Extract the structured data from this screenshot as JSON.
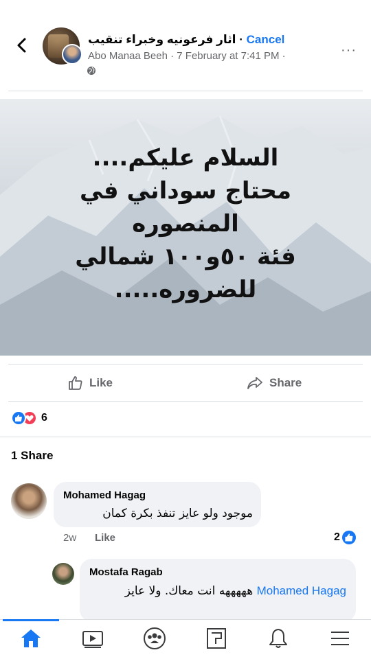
{
  "header": {
    "group_name": "اثار فرعونيه وخبراء تنقيب",
    "separator": " · ",
    "cancel_label": "Cancel",
    "author": "Abo Manaa Beeh",
    "timestamp": "7 February at 7:41 PM",
    "meta_separator": " · ",
    "privacy_icon": "globe-icon",
    "back_icon": "chevron-left-icon",
    "more_label": "···"
  },
  "post": {
    "lines": [
      "السلام عليكم....",
      "محتاج سوداني في",
      "المنصوره",
      "فئة ٥٠و١٠٠ شمالي",
      "للضروره....."
    ]
  },
  "actions": {
    "like_label": "Like",
    "share_label": "Share"
  },
  "reactions": {
    "count": "6",
    "types": [
      "like",
      "love"
    ]
  },
  "shares_label": "1 Share",
  "comments": [
    {
      "name": "Mohamed Hagag",
      "text": "موجود ولو عايز تنفذ بكرة كمان",
      "time": "2w",
      "like_label": "Like",
      "reaction_count": "2"
    },
    {
      "name": "Mostafa Ragab",
      "mention": "Mohamed Hagag",
      "text": "هههههه انت معاك. ولا عايز"
    }
  ],
  "nav": {
    "items": [
      "home-icon",
      "video-icon",
      "groups-icon",
      "pages-icon",
      "notifications-icon",
      "menu-icon"
    ],
    "active": "home-icon"
  },
  "colors": {
    "accent": "#1877f2",
    "secondary_text": "#65676b",
    "love": "#f33e58",
    "bubble": "#f0f2f5"
  }
}
